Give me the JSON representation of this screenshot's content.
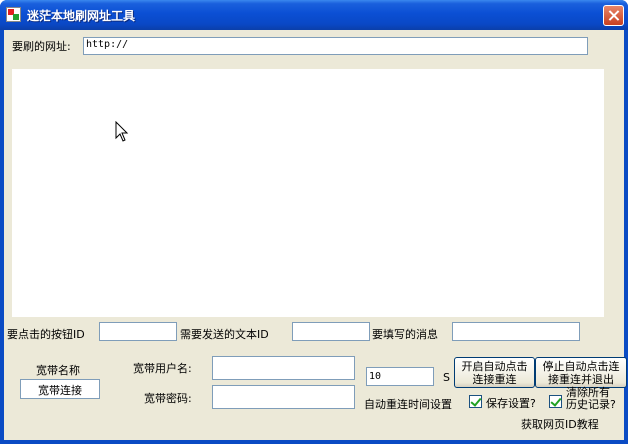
{
  "window": {
    "title": "迷茫本地刷网址工具"
  },
  "url_row": {
    "label": "要刷的网址:",
    "value": "http://"
  },
  "ids_row": {
    "button_id_label": "要点击的按钮ID",
    "button_id_value": "",
    "text_id_label": "需要发送的文本ID",
    "text_id_value": "",
    "message_label": "要填写的消息",
    "message_value": ""
  },
  "broadband": {
    "name_label": "宽带名称",
    "name_value": "宽带连接",
    "username_label": "宽带用户名:",
    "username_value": "",
    "password_label": "宽带密码:",
    "password_value": ""
  },
  "reconnect": {
    "interval_value": "10",
    "unit": "S",
    "setting_label": "自动重连时间设置",
    "start_button": [
      "开启自动点击",
      "连接重连"
    ],
    "stop_button": [
      "停止自动点击连",
      "接重连并退出"
    ]
  },
  "options": {
    "save_settings": "保存设置?",
    "save_checked": true,
    "clear_history": [
      "清除所有",
      "历史记录?"
    ],
    "clear_checked": true
  },
  "footer": {
    "tutorial_link": "获取网页ID教程"
  }
}
